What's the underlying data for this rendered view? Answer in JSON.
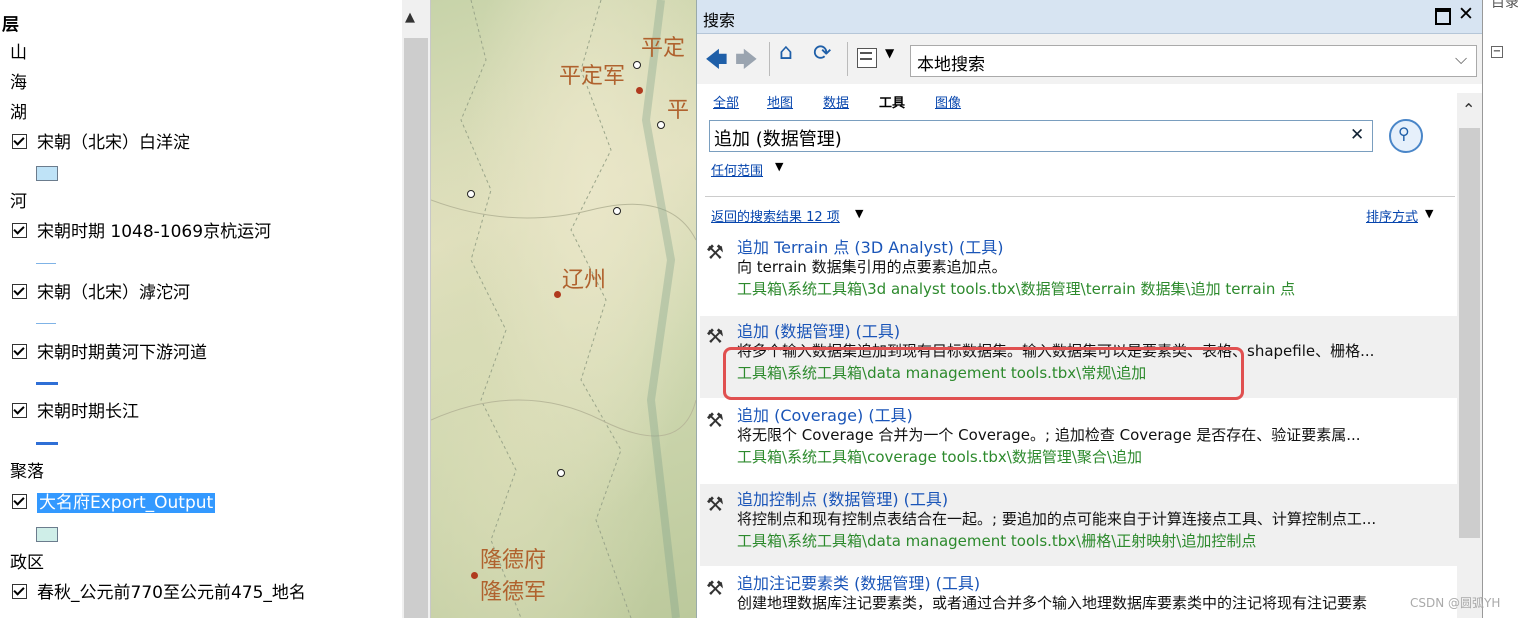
{
  "toc": {
    "title": "层",
    "rows": [
      {
        "label": "山",
        "type": "group"
      },
      {
        "label": "海",
        "type": "group"
      },
      {
        "label": "湖",
        "type": "group"
      },
      {
        "label": "宋朝（北宋）白洋淀",
        "type": "layer",
        "symbol": "rect",
        "color": "#bfe3f7"
      },
      {
        "label": "河",
        "type": "group"
      },
      {
        "label": "宋朝时期 1048-1069京杭运河",
        "type": "layer",
        "symbol": "line-thin",
        "color": "#7fb3e6"
      },
      {
        "label": "宋朝（北宋）滹沱河",
        "type": "layer",
        "symbol": "line-thin",
        "color": "#7fb3e6"
      },
      {
        "label": "宋朝时期黄河下游河道",
        "type": "layer",
        "symbol": "line-thick",
        "color": "#2f6fd6"
      },
      {
        "label": "宋朝时期长江",
        "type": "layer",
        "symbol": "line-thick",
        "color": "#2f6fd6"
      },
      {
        "label": "聚落",
        "type": "group"
      },
      {
        "label": "大名府Export_Output",
        "type": "layer",
        "symbol": "rect",
        "color": "#cfeee8",
        "selected": true
      },
      {
        "label": "政区",
        "type": "group"
      },
      {
        "label": "春秋_公元前770至公元前475_地名",
        "type": "layer"
      }
    ]
  },
  "map": {
    "labels": [
      "平定军",
      "平定",
      "平",
      "辽州",
      "隆德府",
      "隆德军"
    ]
  },
  "search": {
    "title": "搜索",
    "scope": "本地搜索",
    "tabs": [
      "全部",
      "地图",
      "数据",
      "工具",
      "图像"
    ],
    "active_tab": "工具",
    "query": "追加 (数据管理)",
    "range_link": "任何范围",
    "results_count": "返回的搜索结果 12 项",
    "sort_label": "排序方式",
    "results": [
      {
        "title": "追加 Terrain 点 (3D Analyst) (工具)",
        "desc": "向 terrain 数据集引用的点要素追加点。",
        "path": "工具箱\\系统工具箱\\3d analyst tools.tbx\\数据管理\\terrain 数据集\\追加 terrain 点"
      },
      {
        "title": "追加 (数据管理) (工具)",
        "desc": "将多个输入数据集追加到现有目标数据集。输入数据集可以是要素类、表格、shapefile、栅格...",
        "path": "工具箱\\系统工具箱\\data management tools.tbx\\常规\\追加"
      },
      {
        "title": "追加 (Coverage) (工具)",
        "desc": "将无限个 Coverage 合并为一个 Coverage。; 追加检查 Coverage 是否存在、验证要素属...",
        "path": "工具箱\\系统工具箱\\coverage tools.tbx\\数据管理\\聚合\\追加"
      },
      {
        "title": "追加控制点 (数据管理) (工具)",
        "desc": "将控制点和现有控制点表结合在一起。; 要追加的点可能来自于计算连接点工具、计算控制点工...",
        "path": "工具箱\\系统工具箱\\data management tools.tbx\\栅格\\正射映射\\追加控制点"
      },
      {
        "title": "追加注记要素类 (数据管理) (工具)",
        "desc": "创建地理数据库注记要素类，或者通过合并多个输入地理数据库要素类中的注记将现有注记要素",
        "path": ""
      }
    ]
  },
  "watermark": "CSDN @圆弧YH",
  "right_panel": {
    "title": "目录"
  }
}
